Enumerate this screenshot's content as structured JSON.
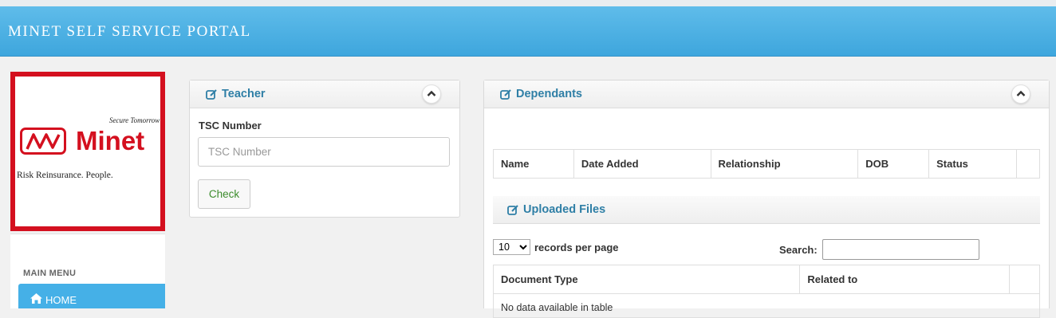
{
  "header": {
    "title": "MINET SELF SERVICE PORTAL"
  },
  "logo": {
    "tagline": "Secure Tomorrow",
    "brand": "Minet",
    "slogan": "Risk Reinsurance. People."
  },
  "sidebar": {
    "menu_label": "MAIN MENU",
    "items": [
      {
        "label": "HOME",
        "icon": "home-icon"
      }
    ]
  },
  "teacher_panel": {
    "title": "Teacher",
    "tsc_label": "TSC Number",
    "tsc_placeholder": "TSC Number",
    "check_label": "Check"
  },
  "dependants_panel": {
    "title": "Dependants",
    "columns": [
      "Name",
      "Date Added",
      "Relationship",
      "DOB",
      "Status"
    ],
    "uploaded": {
      "title": "Uploaded Files",
      "length_value": "10",
      "length_options": [
        "10"
      ],
      "records_text": "records per page",
      "search_label": "Search:",
      "columns": [
        "Document Type",
        "Related to"
      ],
      "empty_text": "No data available in table"
    }
  },
  "colors": {
    "header": "#45aee3",
    "brand_red": "#d4101f",
    "title_blue": "#2f7fa6",
    "menu_active": "#45b0e7",
    "check_green": "#3c8c2c"
  }
}
